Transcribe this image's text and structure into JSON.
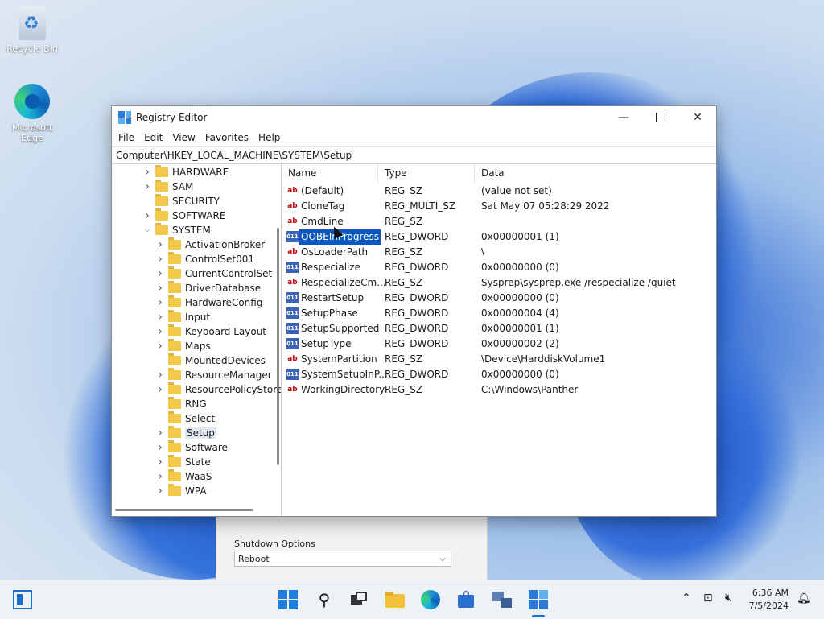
{
  "desktop": {
    "icons": [
      {
        "label": "Recycle Bin",
        "icon": "recycle-bin-icon"
      },
      {
        "label": "Microsoft Edge",
        "icon": "edge-icon"
      }
    ]
  },
  "background_dialog": {
    "label": "Shutdown Options",
    "select_value": "Reboot"
  },
  "window": {
    "title": "Registry Editor",
    "menu": [
      "File",
      "Edit",
      "View",
      "Favorites",
      "Help"
    ],
    "address": "Computer\\HKEY_LOCAL_MACHINE\\SYSTEM\\Setup"
  },
  "tree": [
    {
      "label": "HARDWARE",
      "expand": "collapsed"
    },
    {
      "label": "SAM",
      "expand": "collapsed"
    },
    {
      "label": "SECURITY",
      "expand": "none"
    },
    {
      "label": "SOFTWARE",
      "expand": "collapsed"
    },
    {
      "label": "SYSTEM",
      "expand": "expanded"
    },
    {
      "label": "ActivationBroker",
      "expand": "collapsed"
    },
    {
      "label": "ControlSet001",
      "expand": "collapsed"
    },
    {
      "label": "CurrentControlSet",
      "expand": "collapsed"
    },
    {
      "label": "DriverDatabase",
      "expand": "collapsed"
    },
    {
      "label": "HardwareConfig",
      "expand": "collapsed"
    },
    {
      "label": "Input",
      "expand": "collapsed"
    },
    {
      "label": "Keyboard Layout",
      "expand": "collapsed"
    },
    {
      "label": "Maps",
      "expand": "collapsed"
    },
    {
      "label": "MountedDevices",
      "expand": "none"
    },
    {
      "label": "ResourceManager",
      "expand": "collapsed"
    },
    {
      "label": "ResourcePolicyStore",
      "expand": "collapsed"
    },
    {
      "label": "RNG",
      "expand": "none"
    },
    {
      "label": "Select",
      "expand": "none"
    },
    {
      "label": "Setup",
      "expand": "collapsed",
      "selected": true
    },
    {
      "label": "Software",
      "expand": "collapsed"
    },
    {
      "label": "State",
      "expand": "collapsed"
    },
    {
      "label": "WaaS",
      "expand": "collapsed"
    },
    {
      "label": "WPA",
      "expand": "collapsed"
    }
  ],
  "list": {
    "columns": [
      "Name",
      "Type",
      "Data"
    ],
    "rows": [
      {
        "name": "(Default)",
        "type": "REG_SZ",
        "data": "(value not set)",
        "icon": "string"
      },
      {
        "name": "CloneTag",
        "type": "REG_MULTI_SZ",
        "data": "Sat May 07 05:28:29 2022",
        "icon": "string"
      },
      {
        "name": "CmdLine",
        "type": "REG_SZ",
        "data": "",
        "icon": "string"
      },
      {
        "name": "OOBEInProgress",
        "type": "REG_DWORD",
        "data": "0x00000001 (1)",
        "icon": "binary",
        "selected": true
      },
      {
        "name": "OsLoaderPath",
        "type": "REG_SZ",
        "data": "\\",
        "icon": "string"
      },
      {
        "name": "Respecialize",
        "type": "REG_DWORD",
        "data": "0x00000000 (0)",
        "icon": "binary"
      },
      {
        "name": "RespecializeCm...",
        "type": "REG_SZ",
        "data": "Sysprep\\sysprep.exe /respecialize /quiet",
        "icon": "string"
      },
      {
        "name": "RestartSetup",
        "type": "REG_DWORD",
        "data": "0x00000000 (0)",
        "icon": "binary"
      },
      {
        "name": "SetupPhase",
        "type": "REG_DWORD",
        "data": "0x00000004 (4)",
        "icon": "binary"
      },
      {
        "name": "SetupSupported",
        "type": "REG_DWORD",
        "data": "0x00000001 (1)",
        "icon": "binary"
      },
      {
        "name": "SetupType",
        "type": "REG_DWORD",
        "data": "0x00000002 (2)",
        "icon": "binary"
      },
      {
        "name": "SystemPartition",
        "type": "REG_SZ",
        "data": "\\Device\\HarddiskVolume1",
        "icon": "string"
      },
      {
        "name": "SystemSetupInP...",
        "type": "REG_DWORD",
        "data": "0x00000000 (0)",
        "icon": "binary"
      },
      {
        "name": "WorkingDirectory",
        "type": "REG_SZ",
        "data": "C:\\Windows\\Panther",
        "icon": "string"
      }
    ]
  },
  "taskbar": {
    "time": "6:36 AM",
    "date": "7/5/2024"
  },
  "colors": {
    "accent": "#0a58c2",
    "taskbar": "#eef1f5"
  }
}
